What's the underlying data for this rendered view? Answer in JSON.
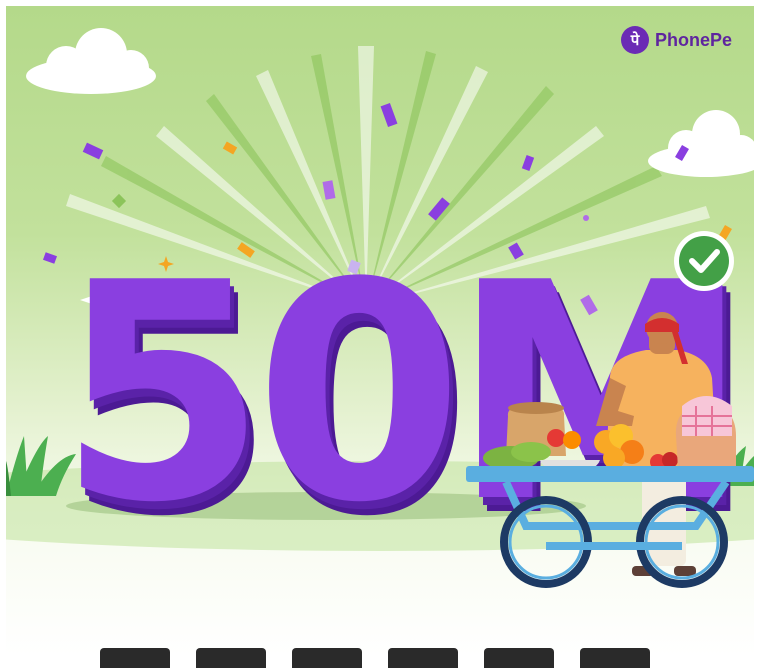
{
  "brand": {
    "name": "PhonePe",
    "mark": "पे"
  },
  "headline": "50M",
  "colors": {
    "sky_top": "#b4d98a",
    "headline_purple": "#8a3fe0",
    "headline_shadow": "#5a22a8",
    "brand_purple": "#5f259f",
    "cart_blue": "#5aaee0",
    "check_green": "#43a047"
  },
  "icons": [
    "cloud-icon",
    "check-badge-icon",
    "sparkle-icon",
    "vendor-cart-illustration",
    "grass-icon"
  ]
}
